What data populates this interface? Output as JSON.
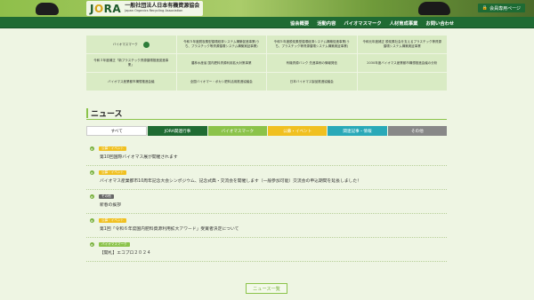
{
  "header": {
    "logo_mark": "JORA",
    "org_name_ja": "一般社団法人日本有機資源協会",
    "org_name_en": "Japan Organics Recycling Association",
    "member_page": "会員専用ページ"
  },
  "nav": {
    "items": [
      "協会概要",
      "活動内容",
      "バイオマスマーク",
      "人材育成事業",
      "お問い合わせ"
    ]
  },
  "dropdown": {
    "cells": [
      "バイオマスマーク",
      "令和５年度脱炭素型循環経済システム構築促進事業(うち、プラスチック等資源循環システム構築実証事業)",
      "令和５年度脱炭素型循環経済システム構築促進事業(うち、プラスチック等資源循環システム構築実証事業)",
      "令和元年度補正 脱炭素社会を支えるプラスチック等資源循環システム構築実証事業",
      "令和３年度補正「新プラスチック資源循環推進促進事業」",
      "農林水産省 国内肥料資源利用拡大対策事業",
      "有機資源バンク 先進事例の情報発信",
      "2030年度バイオマス産業都市構想推進会議の分析",
      "バイオマス産業都市構想推進会議",
      "全国バイオマー・ボカシ肥料活用推進協議会",
      "日本バイオマス製品推進協議会",
      ""
    ],
    "bio_icon": "leaf-icon"
  },
  "news": {
    "heading": "ニュース",
    "tabs": [
      {
        "label": "すべて",
        "color": "#ffffff"
      },
      {
        "label": "JORA関連行事",
        "color": "#1f6b33"
      },
      {
        "label": "バイオマスマーク",
        "color": "#8bc34a"
      },
      {
        "label": "公募・イベント",
        "color": "#f0c020"
      },
      {
        "label": "関連記事・情報",
        "color": "#29a9b8"
      },
      {
        "label": "その他",
        "color": "#888888"
      }
    ],
    "items": [
      {
        "badge": "公募・イベント",
        "badge_color": "#f0c020",
        "title": "第10回国際バイオマス展が開催されます"
      },
      {
        "badge": "公募・イベント",
        "badge_color": "#f0c020",
        "title": "バイオマス産業都市10周年記念大会シンポジウム、記念式典・交流会を開催します（一般参加可能）交流会の申込期間を延長しました！"
      },
      {
        "badge": "その他",
        "badge_color": "#666666",
        "title": "新春の挨拶"
      },
      {
        "badge": "公募・イベント",
        "badge_color": "#f0c020",
        "title": "第1回「令和６年度国内肥料資源利用拡大アワード」受賞者決定について"
      },
      {
        "badge": "バイオマスマーク",
        "badge_color": "#8bc34a",
        "title": "【開札】エコプロ２０２４"
      }
    ],
    "more_button": "ニュース一覧"
  }
}
